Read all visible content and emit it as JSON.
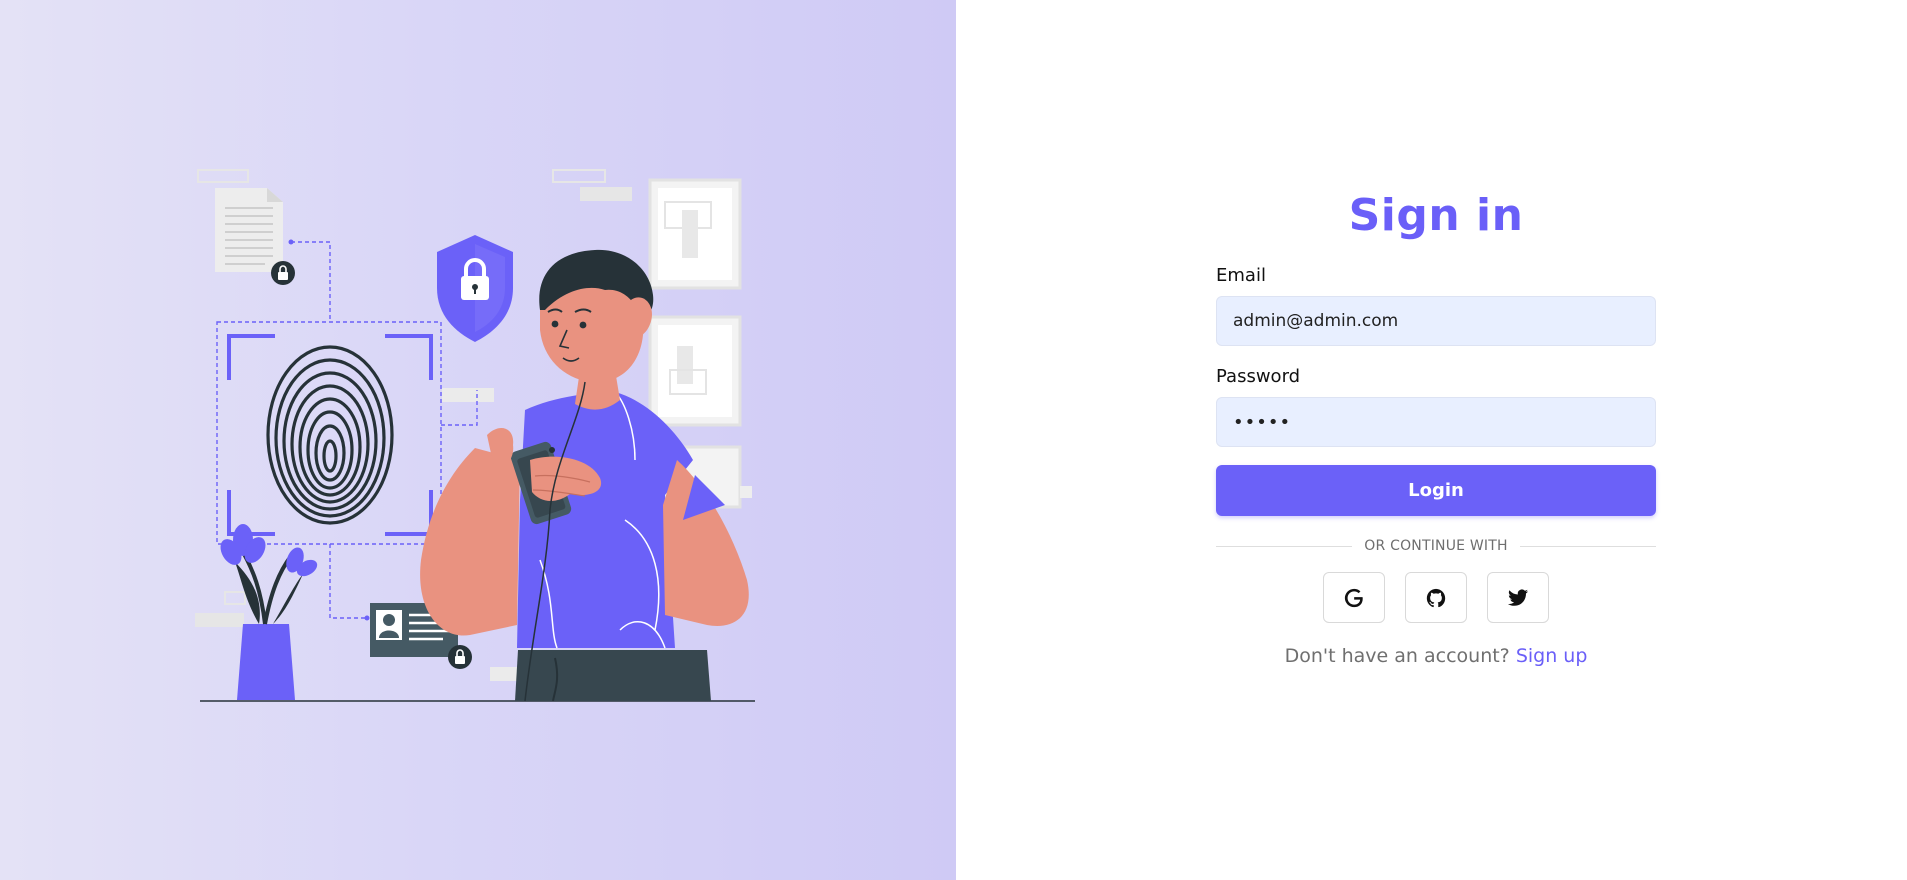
{
  "theme": {
    "accent": "#6b61f8",
    "input_bg": "#e8efff",
    "left_panel_bg": "#d9d6f7",
    "skin": "#e99280",
    "hair": "#263238"
  },
  "illustration": {
    "subject": "man holding phone with fingerprint security, shield lock, plant, document and ID card"
  },
  "login_form": {
    "title": "Sign in",
    "email_label": "Email",
    "email_value": "admin@admin.com",
    "password_label": "Password",
    "password_value": "•••••",
    "login_button": "Login",
    "divider_text": "OR CONTINUE WITH",
    "social": {
      "google_icon": "google-icon",
      "github_icon": "github-icon",
      "twitter_icon": "twitter-icon"
    },
    "signup_prompt": "Don't have an account?",
    "signup_link": "Sign up"
  }
}
